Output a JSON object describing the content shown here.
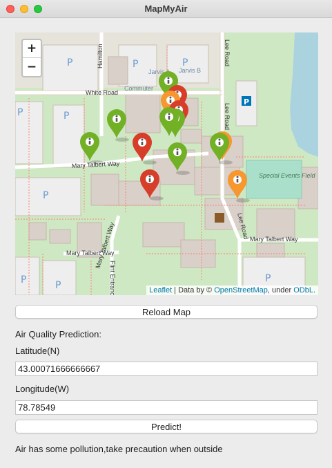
{
  "window": {
    "title": "MapMyAir"
  },
  "map": {
    "zoom_in": "+",
    "zoom_out": "−",
    "attribution": {
      "leaflet": "Leaflet",
      "sep1": " | Data by © ",
      "osm": "OpenStreetMap",
      "sep2": ", under ",
      "odbl": "ODbL."
    },
    "labels": {
      "hamilton": "Hamilton",
      "lee_road_top": "Lee Road",
      "lee_road_mid": "Lee Road",
      "lee_road_bottom": "Lee Road",
      "white_road": "White Road",
      "mary_talbert_way_1": "Mary Talbert Way",
      "mary_talbert_way_2": "Mary Talbert Way",
      "mary_talbert_way_3": "Mary Talbert Way",
      "mary_talbert_way_4": "Mary Talbert Way",
      "flint_entrance": "Flint Entrance",
      "jarvis_a": "Jarvis A",
      "jarvis_b": "Jarvis B",
      "commuter": "Commuter",
      "special_events_field": "Special Events Field"
    },
    "marker_colors": {
      "good": "#72b026",
      "moderate": "#f69730",
      "unhealthy": "#d63e2a"
    }
  },
  "reload_button": "Reload Map",
  "prediction_heading": "Air Quality Prediction:",
  "latitude": {
    "label": "Latitude(N)",
    "value": "43.00071666666667"
  },
  "longitude": {
    "label": "Longitude(W)",
    "value": "78.78549"
  },
  "predict_button": "Predict!",
  "result_text": "Air has some pollution,take precaution when outside"
}
